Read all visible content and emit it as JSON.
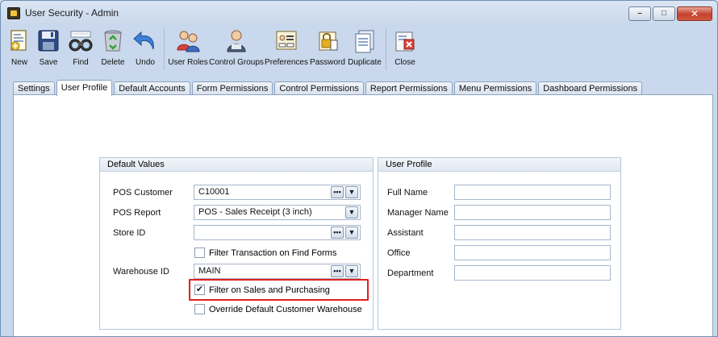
{
  "window": {
    "title": "User Security - Admin",
    "minimize_glyph": "–",
    "maximize_glyph": "□",
    "close_glyph": "✕"
  },
  "toolbar": {
    "new": "New",
    "save": "Save",
    "find": "Find",
    "delete": "Delete",
    "undo": "Undo",
    "user_roles": "User Roles",
    "control_groups": "Control Groups",
    "preferences": "Preferences",
    "password": "Password",
    "duplicate": "Duplicate",
    "close": "Close"
  },
  "tabs": [
    {
      "label": "Settings"
    },
    {
      "label": "User Profile",
      "active": true
    },
    {
      "label": "Default Accounts"
    },
    {
      "label": "Form Permissions"
    },
    {
      "label": "Control Permissions"
    },
    {
      "label": "Report Permissions"
    },
    {
      "label": "Menu Permissions"
    },
    {
      "label": "Dashboard Permissions"
    }
  ],
  "default_values": {
    "header": "Default Values",
    "pos_customer_label": "POS Customer",
    "pos_customer_value": "C10001",
    "pos_report_label": "POS Report",
    "pos_report_value": "POS - Sales Receipt (3 inch)",
    "store_id_label": "Store ID",
    "store_id_value": "",
    "filter_transaction_label": "Filter Transaction on Find Forms",
    "filter_transaction_checked": false,
    "warehouse_id_label": "Warehouse ID",
    "warehouse_id_value": "MAIN",
    "filter_sales_label": "Filter on Sales and Purchasing",
    "filter_sales_checked": true,
    "override_warehouse_label": "Override Default Customer Warehouse",
    "override_warehouse_checked": false,
    "ellipsis_glyph": "•••",
    "dropdown_glyph": "▼",
    "check_glyph": "✔"
  },
  "user_profile": {
    "header": "User Profile",
    "full_name_label": "Full Name",
    "full_name_value": "",
    "manager_name_label": "Manager Name",
    "manager_name_value": "",
    "assistant_label": "Assistant",
    "assistant_value": "",
    "office_label": "Office",
    "office_value": "",
    "department_label": "Department",
    "department_value": ""
  },
  "colors": {
    "highlight": "#e0201e",
    "tab_border": "#8ea3bf"
  }
}
